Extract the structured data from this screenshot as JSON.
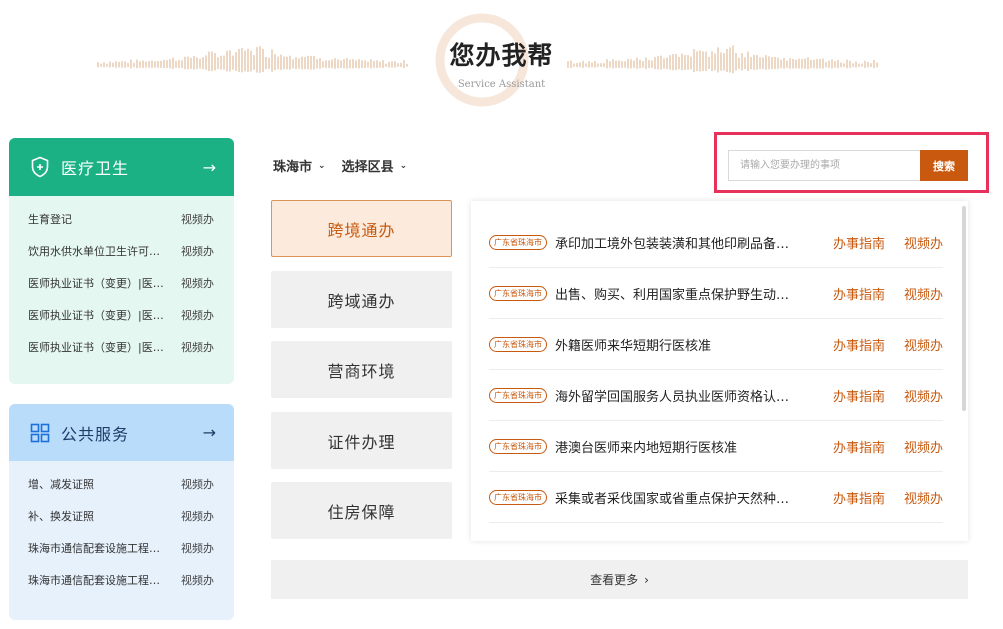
{
  "header": {
    "title": "您办我帮",
    "subtitle": "Service Assistant"
  },
  "left_cards": [
    {
      "title": "医疗卫生",
      "icon": "shield-icon",
      "arrow": "→",
      "items": [
        {
          "label": "生育登记",
          "action": "视频办"
        },
        {
          "label": "饮用水供水单位卫生许可…",
          "action": "视频办"
        },
        {
          "label": "医师执业证书（变更）|医…",
          "action": "视频办"
        },
        {
          "label": "医师执业证书（变更）|医…",
          "action": "视频办"
        },
        {
          "label": "医师执业证书（变更）|医…",
          "action": "视频办"
        }
      ]
    },
    {
      "title": "公共服务",
      "icon": "grid-icon",
      "arrow": "→",
      "items": [
        {
          "label": "增、减发证照",
          "action": "视频办"
        },
        {
          "label": "补、换发证照",
          "action": "视频办"
        },
        {
          "label": "珠海市通信配套设施工程…",
          "action": "视频办"
        },
        {
          "label": "珠海市通信配套设施工程…",
          "action": "视频办"
        }
      ]
    }
  ],
  "filters": {
    "city": "珠海市",
    "district": "选择区县"
  },
  "search": {
    "placeholder": "请输入您要办理的事项",
    "button": "搜索"
  },
  "tabs": [
    "跨境通办",
    "跨域通办",
    "营商环境",
    "证件办理",
    "住房保障"
  ],
  "active_tab": "跨境通办",
  "services": [
    {
      "tag": "广东省珠海市",
      "title": "承印加工境外包装装潢和其他印刷品备…",
      "guide": "办事指南",
      "video": "视频办"
    },
    {
      "tag": "广东省珠海市",
      "title": "出售、购买、利用国家重点保护野生动…",
      "guide": "办事指南",
      "video": "视频办"
    },
    {
      "tag": "广东省珠海市",
      "title": "外籍医师来华短期行医核准",
      "guide": "办事指南",
      "video": "视频办"
    },
    {
      "tag": "广东省珠海市",
      "title": "海外留学回国服务人员执业医师资格认…",
      "guide": "办事指南",
      "video": "视频办"
    },
    {
      "tag": "广东省珠海市",
      "title": "港澳台医师来内地短期行医核准",
      "guide": "办事指南",
      "video": "视频办"
    },
    {
      "tag": "广东省珠海市",
      "title": "采集或者采伐国家或省重点保护天然种…",
      "guide": "办事指南",
      "video": "视频办"
    }
  ],
  "more": {
    "label": "查看更多",
    "chevron": "›"
  },
  "colors": {
    "accent": "#c8590f",
    "medical_green": "#1bb184",
    "public_blue": "#b9dcfb",
    "highlight_border": "#e8315a"
  }
}
